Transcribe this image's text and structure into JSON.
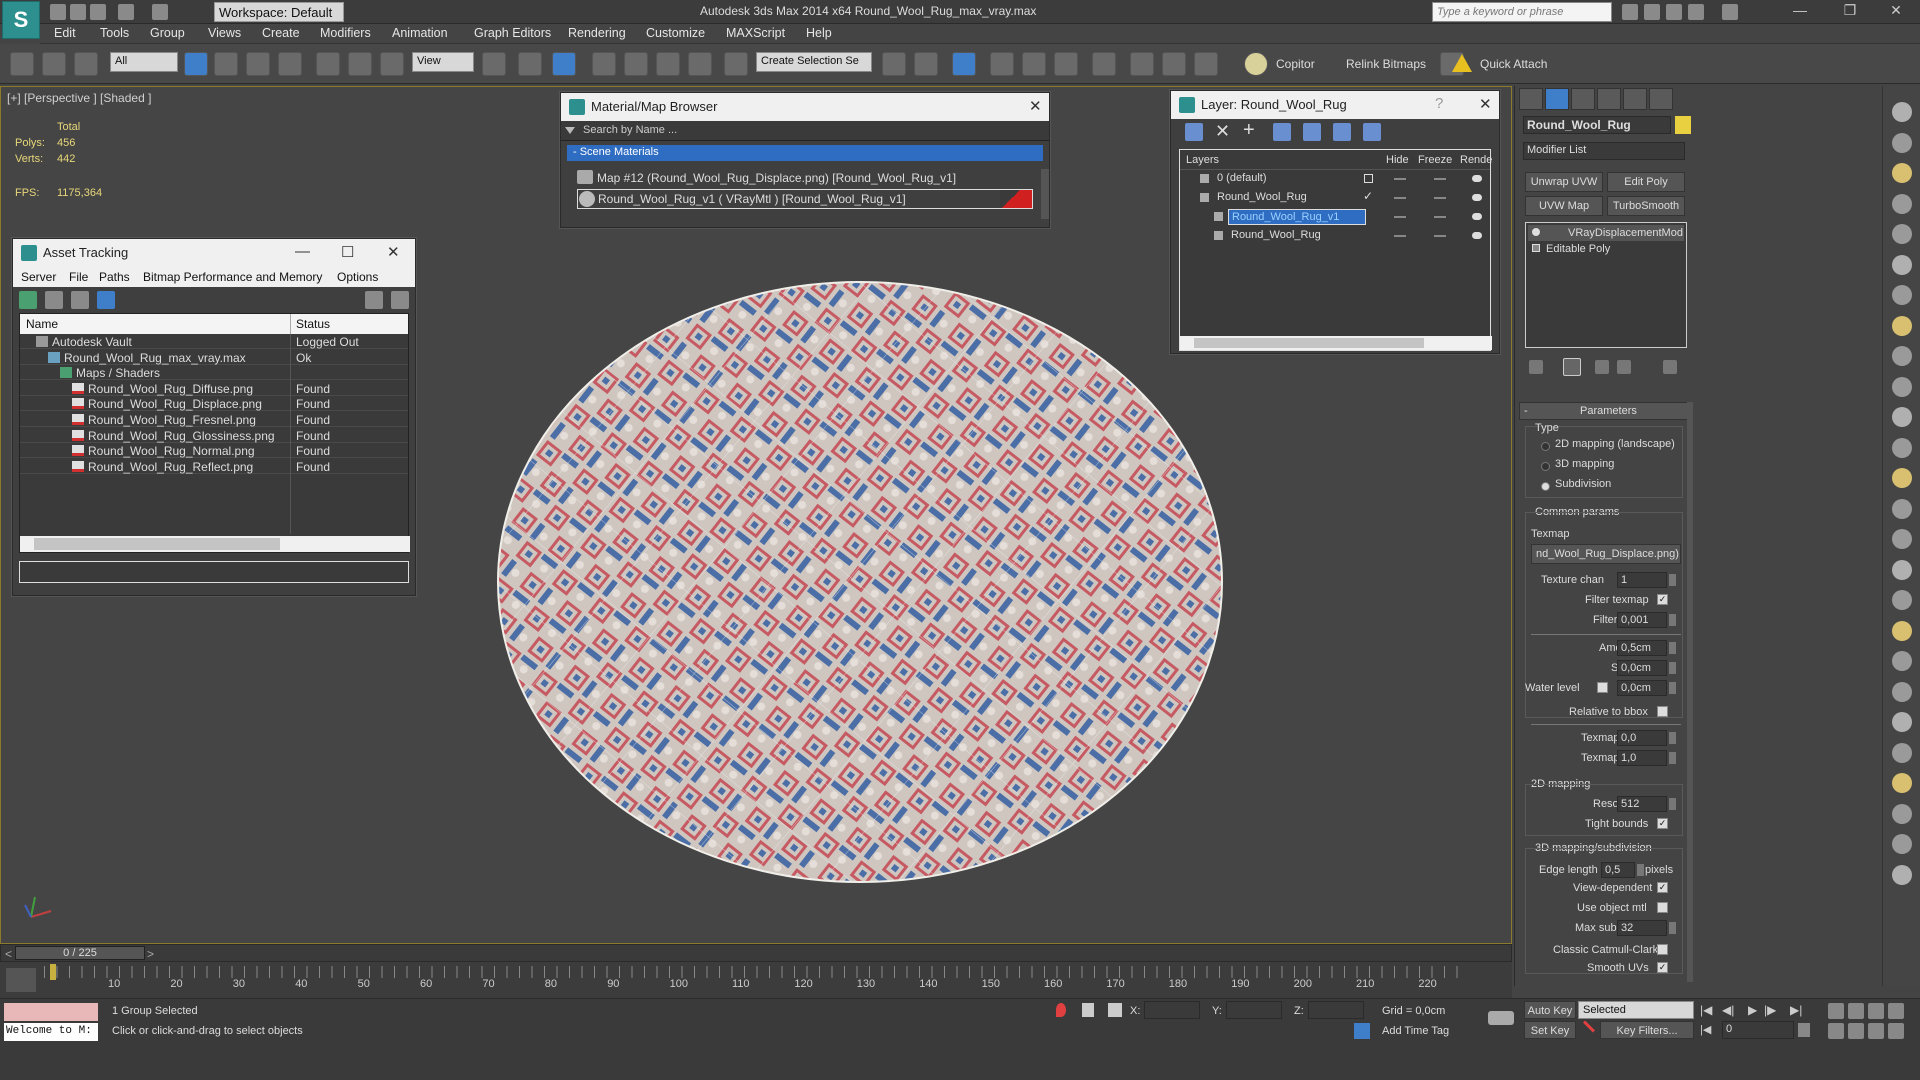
{
  "titlebar": {
    "workspace": "Workspace: Default",
    "app_title": "Autodesk 3ds Max  2014 x64     Round_Wool_Rug_max_vray.max",
    "search_placeholder": "Type a keyword or phrase"
  },
  "menu": [
    "Edit",
    "Tools",
    "Group",
    "Views",
    "Create",
    "Modifiers",
    "Animation",
    "Graph Editors",
    "Rendering",
    "Customize",
    "MAXScript",
    "Help"
  ],
  "toolbar": {
    "filter_select": "All",
    "view_select": "View",
    "selection_set": "Create Selection Se",
    "copitor": "Copitor",
    "relink": "Relink Bitmaps",
    "quick_attach": "Quick Attach"
  },
  "viewport": {
    "label": "[+] [Perspective ] [Shaded ]",
    "stats_total": "Total",
    "polys_label": "Polys:",
    "polys_value": "456",
    "verts_label": "Verts:",
    "verts_value": "442",
    "fps_label": "FPS:",
    "fps_value": "1175,364"
  },
  "asset_tracking": {
    "title": "Asset Tracking",
    "menu": [
      "Server",
      "File",
      "Paths",
      "Bitmap Performance and Memory",
      "Options"
    ],
    "col_name": "Name",
    "col_status": "Status",
    "rows": [
      {
        "name": "Autodesk Vault",
        "status": "Logged Out",
        "indent": 0
      },
      {
        "name": "Round_Wool_Rug_max_vray.max",
        "status": "Ok",
        "indent": 1
      },
      {
        "name": "Maps / Shaders",
        "status": "",
        "indent": 2
      },
      {
        "name": "Round_Wool_Rug_Diffuse.png",
        "status": "Found",
        "indent": 3
      },
      {
        "name": "Round_Wool_Rug_Displace.png",
        "status": "Found",
        "indent": 3
      },
      {
        "name": "Round_Wool_Rug_Fresnel.png",
        "status": "Found",
        "indent": 3
      },
      {
        "name": "Round_Wool_Rug_Glossiness.png",
        "status": "Found",
        "indent": 3
      },
      {
        "name": "Round_Wool_Rug_Normal.png",
        "status": "Found",
        "indent": 3
      },
      {
        "name": "Round_Wool_Rug_Reflect.png",
        "status": "Found",
        "indent": 3
      }
    ]
  },
  "material_browser": {
    "title": "Material/Map Browser",
    "search_placeholder": "Search by Name ...",
    "section": "- Scene Materials",
    "items": [
      "Map #12 (Round_Wool_Rug_Displace.png) [Round_Wool_Rug_v1]",
      "Round_Wool_Rug_v1  ( VRayMtl )  [Round_Wool_Rug_v1]"
    ]
  },
  "layer_window": {
    "title": "Layer: Round_Wool_Rug",
    "help": "?",
    "col_layers": "Layers",
    "col_hide": "Hide",
    "col_freeze": "Freeze",
    "col_render": "Rende",
    "rows": [
      {
        "name": "0 (default)",
        "indent": 0,
        "selected": false
      },
      {
        "name": "Round_Wool_Rug",
        "indent": 0,
        "selected": false
      },
      {
        "name": "Round_Wool_Rug_v1",
        "indent": 1,
        "selected": true
      },
      {
        "name": "Round_Wool_Rug",
        "indent": 1,
        "selected": false
      }
    ]
  },
  "command_panel": {
    "object_name": "Round_Wool_Rug",
    "modifier_list": "Modifier List",
    "btn_unwrap": "Unwrap UVW",
    "btn_editpoly": "Edit Poly",
    "btn_uvwmap": "UVW Map",
    "btn_turbosmooth": "TurboSmooth",
    "stack": [
      "VRayDisplacementMod",
      "Editable Poly"
    ],
    "rollout_params": "Parameters",
    "type_label": "Type",
    "type_options": [
      "2D mapping (landscape)",
      "3D mapping",
      "Subdivision"
    ],
    "common_params": "Common params",
    "texmap_label": "Texmap",
    "texmap_value": "nd_Wool_Rug_Displace.png)",
    "texture_chan_label": "Texture chan",
    "texture_chan_value": "1",
    "filter_texmap_label": "Filter texmap",
    "filter_blur_label": "Filter blur",
    "filter_blur_value": "0,001",
    "amount_label": "Amount",
    "amount_value": "0,5cm",
    "shift_label": "Shift",
    "shift_value": "0,0cm",
    "water_level_label": "Water level",
    "water_level_value": "0,0cm",
    "relative_bbox_label": "Relative to bbox",
    "texmap_min_label": "Texmap min",
    "texmap_min_value": "0,0",
    "texmap_max_label": "Texmap max",
    "texmap_max_value": "1,0",
    "mapping2d_label": "2D mapping",
    "resolution_label": "Resolution",
    "resolution_value": "512",
    "tight_bounds_label": "Tight bounds",
    "mapping3d_label": "3D mapping/subdivision",
    "edge_length_label": "Edge length",
    "edge_length_value": "0,5",
    "pixels_label": "pixels",
    "view_dependent_label": "View-dependent",
    "use_object_mtl_label": "Use object mtl",
    "max_subdivs_label": "Max subdivs",
    "max_subdivs_value": "32",
    "classic_cc_label": "Classic Catmull-Clark",
    "smooth_uvs_label": "Smooth UVs"
  },
  "timeline": {
    "frame_counter": "0 / 225",
    "ticks": [
      "10",
      "20",
      "30",
      "40",
      "50",
      "60",
      "70",
      "80",
      "90",
      "100",
      "110",
      "120",
      "130",
      "140",
      "150",
      "160",
      "170",
      "180",
      "190",
      "200",
      "210",
      "220"
    ]
  },
  "status": {
    "welcome": "Welcome to M:",
    "selected_info": "1 Group Selected",
    "prompt": "Click or click-and-drag to select objects",
    "x_label": "X:",
    "y_label": "Y:",
    "z_label": "Z:",
    "grid": "Grid = 0,0cm",
    "add_time_tag": "Add Time Tag",
    "auto_key": "Auto Key",
    "selected_dropdown": "Selected",
    "set_key": "Set Key",
    "key_filters": "Key Filters...",
    "frame_value": "0"
  }
}
